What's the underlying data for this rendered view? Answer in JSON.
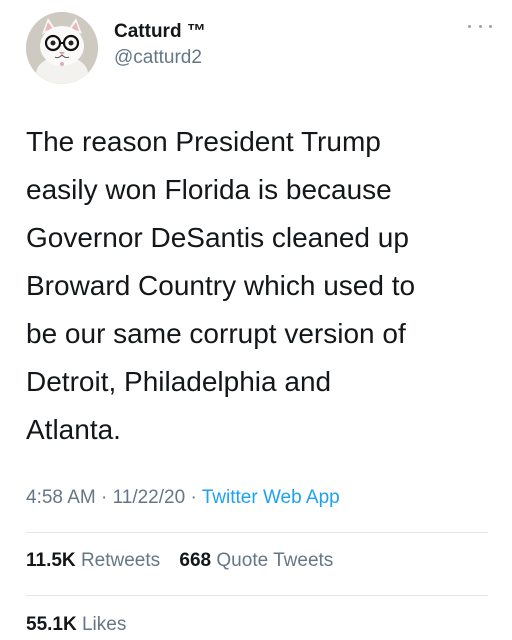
{
  "user": {
    "display_name": "Catturd ™",
    "handle": "@catturd2"
  },
  "tweet": {
    "text": "The reason President Trump\neasily won Florida is because\nGovernor DeSantis cleaned up\nBroward Country which used to\nbe our same corrupt version of\nDetroit, Philadelphia and\nAtlanta.",
    "time": "4:58 AM",
    "date": "11/22/20",
    "separator": "·",
    "source": "Twitter Web App"
  },
  "stats": {
    "retweets_count": "11.5K",
    "retweets_label": "Retweets",
    "quote_count": "668",
    "quote_label": "Quote Tweets",
    "likes_count": "55.1K",
    "likes_label": "Likes"
  },
  "icons": {
    "avatar": "cat-with-glasses-avatar",
    "more": "more-options-icon"
  },
  "colors": {
    "text": "#14171a",
    "secondary": "#657786",
    "link": "#1da1f2",
    "divider": "#e1e8ed"
  }
}
